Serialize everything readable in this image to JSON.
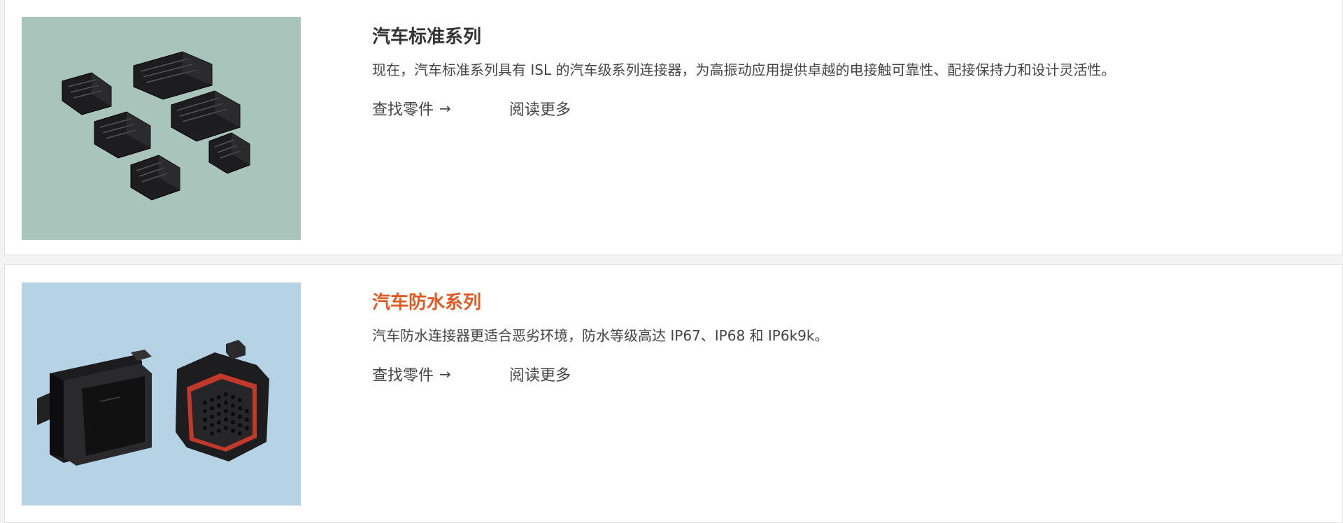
{
  "products": [
    {
      "title": "汽车标准系列",
      "description": "现在，汽车标准系列具有 ISL 的汽车级系列连接器，为高振动应用提供卓越的电接触可靠性、配接保持力和设计灵活性。",
      "find_parts_label": "查找零件",
      "find_parts_icon": "arrow-right-icon",
      "read_more_label": "阅读更多",
      "image_bg": "#a9c4ba",
      "title_color": "#333333"
    },
    {
      "title": "汽车防水系列",
      "description": "汽车防水连接器更适合恶劣环境，防水等级高达 IP67、IP68 和 IP6k9k。",
      "find_parts_label": "查找零件",
      "find_parts_icon": "arrow-right-icon",
      "read_more_label": "阅读更多",
      "image_bg": "#b5d3e5",
      "title_color": "#e05a23"
    }
  ]
}
